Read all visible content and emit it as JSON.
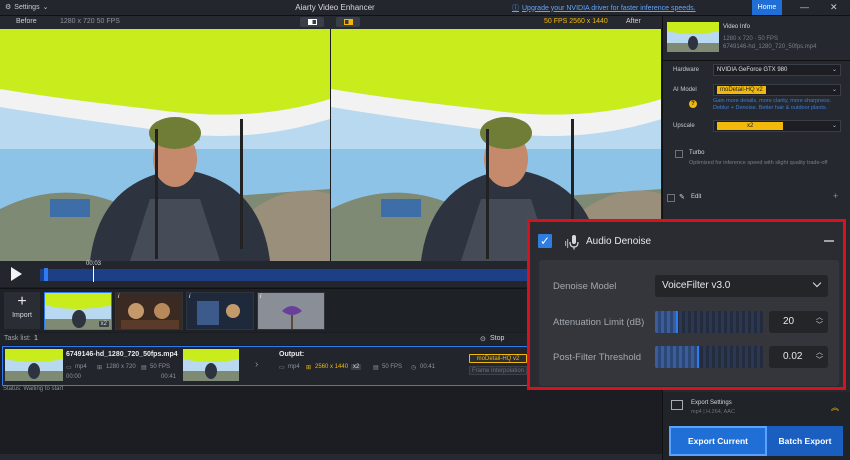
{
  "titlebar": {
    "settings": "Settings",
    "title": "Aiarty Video Enhancer",
    "driver_link": "Upgrade your NVIDIA driver for faster inference speeds.",
    "home": "Home",
    "minimize": "—",
    "close": "✕"
  },
  "preview": {
    "before_label": "Before",
    "before_meta": "1280 x 720  50 FPS",
    "after_label": "After",
    "after_meta": "50 FPS  2560 x 1440",
    "time": "00:03"
  },
  "thumbs": {
    "import": "Import",
    "badge": "x2"
  },
  "tasklist": {
    "label": "Task list:",
    "count": "1",
    "stop": "Stop",
    "file_name": "6749146-hd_1280_720_50fps.mp4",
    "in_format": "mp4",
    "in_res": "1280 x 720",
    "in_fps": "50 FPS",
    "in_start": "00:00",
    "in_end": "00:41",
    "output_label": "Output:",
    "out_format": "mp4",
    "out_res": "2560 x 1440",
    "out_badge": "x2",
    "out_fps": "50 FPS",
    "out_dur": "00:41",
    "model_tag": "moDetail-HQ  v2",
    "frame_interp": "Frame Interpolation",
    "status": "Status: Waiting to start"
  },
  "panel": {
    "video_info": "Video Info",
    "vi_line1": "1280 x 720 · 50 FPS",
    "vi_line2": "6749146-hd_1280_720_50fps.mp4",
    "hardware_label": "Hardware",
    "hardware_value": "NVIDIA GeForce GTX 980",
    "ai_model_label": "AI Model",
    "ai_model_value": "moDetail-HQ  v2",
    "ai_model_hint": "Gain more details, more clarity, more sharpness. Deblur + Denoise. Better hair & outdoor plants.",
    "upscale_label": "Upscale",
    "upscale_value": "x2",
    "turbo_label": "Turbo",
    "turbo_hint": "Optimized for inference speed with slight quality trade-off",
    "edit_label": "Edit",
    "export_settings": "Export Settings",
    "export_sub": "mp4 | H.264, AAC",
    "export_current": "Export Current",
    "batch_export": "Batch Export"
  },
  "denoise": {
    "title": "Audio Denoise",
    "model_label": "Denoise Model",
    "model_value": "VoiceFilter v3.0",
    "atten_label": "Attenuation Limit (dB)",
    "atten_value": "20",
    "atten_fraction": 0.2,
    "post_label": "Post-Filter Threshold",
    "post_value": "0.02",
    "post_fraction": 0.4
  },
  "colors": {
    "accent": "#2e7cf0",
    "highlight_yellow": "#f2b90c",
    "frame_red": "#d6121e"
  }
}
